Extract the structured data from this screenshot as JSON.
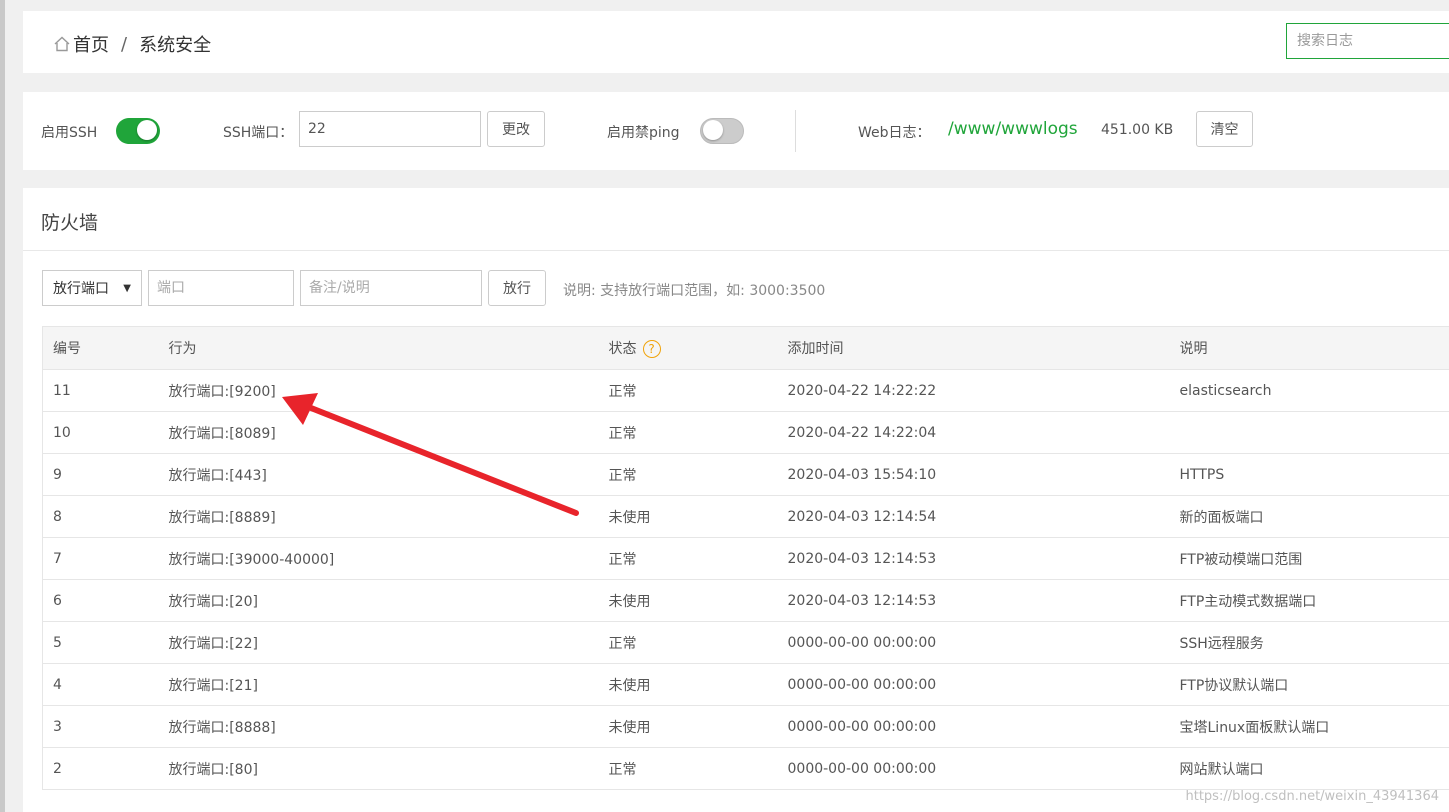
{
  "breadcrumb": {
    "home": "首页",
    "separator": "/",
    "current": "系统安全"
  },
  "search": {
    "placeholder": "搜索日志"
  },
  "config": {
    "ssh_label": "启用SSH",
    "ssh_enabled": true,
    "ssh_port_label": "SSH端口：",
    "ssh_port_value": "22",
    "change_button": "更改",
    "ping_label": "启用禁ping",
    "ping_enabled": false,
    "web_log_label": "Web日志：",
    "web_log_path": "/www/wwwlogs",
    "web_log_size": "451.00 KB",
    "clear_button": "清空"
  },
  "firewall": {
    "title": "防火墙",
    "select_value": "放行端口",
    "port_placeholder": "端口",
    "note_placeholder": "备注/说明",
    "allow_button": "放行",
    "hint": "说明: 支持放行端口范围，如: 3000:3500",
    "columns": [
      "编号",
      "行为",
      "状态",
      "添加时间",
      "说明"
    ],
    "rows": [
      {
        "id": "11",
        "action": "放行端口:[9200]",
        "status": "正常",
        "time": "2020-04-22 14:22:22",
        "note": "elasticsearch"
      },
      {
        "id": "10",
        "action": "放行端口:[8089]",
        "status": "正常",
        "time": "2020-04-22 14:22:04",
        "note": ""
      },
      {
        "id": "9",
        "action": "放行端口:[443]",
        "status": "正常",
        "time": "2020-04-03 15:54:10",
        "note": "HTTPS"
      },
      {
        "id": "8",
        "action": "放行端口:[8889]",
        "status": "未使用",
        "time": "2020-04-03 12:14:54",
        "note": "新的面板端口"
      },
      {
        "id": "7",
        "action": "放行端口:[39000-40000]",
        "status": "正常",
        "time": "2020-04-03 12:14:53",
        "note": "FTP被动模端口范围"
      },
      {
        "id": "6",
        "action": "放行端口:[20]",
        "status": "未使用",
        "time": "2020-04-03 12:14:53",
        "note": "FTP主动模式数据端口"
      },
      {
        "id": "5",
        "action": "放行端口:[22]",
        "status": "正常",
        "time": "0000-00-00 00:00:00",
        "note": "SSH远程服务"
      },
      {
        "id": "4",
        "action": "放行端口:[21]",
        "status": "未使用",
        "time": "0000-00-00 00:00:00",
        "note": "FTP协议默认端口"
      },
      {
        "id": "3",
        "action": "放行端口:[8888]",
        "status": "未使用",
        "time": "0000-00-00 00:00:00",
        "note": "宝塔Linux面板默认端口"
      },
      {
        "id": "2",
        "action": "放行端口:[80]",
        "status": "正常",
        "time": "0000-00-00 00:00:00",
        "note": "网站默认端口"
      }
    ]
  },
  "watermark": "https://blog.csdn.net/weixin_43941364",
  "icons": {
    "home": "home-icon",
    "help": "help-icon",
    "caret": "caret-down-icon",
    "annotation": "red-arrow-annotation"
  },
  "colors": {
    "accent": "#20a53a",
    "help": "#f0a30a",
    "arrow": "#e8242b"
  }
}
